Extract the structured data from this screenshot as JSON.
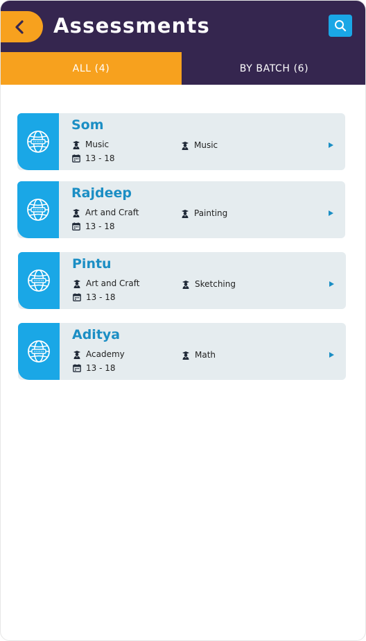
{
  "header": {
    "title": "Assessments",
    "back_icon": "chevron-left-icon",
    "search_icon": "search-icon"
  },
  "tabs": [
    {
      "label": "ALL (4)",
      "active": true
    },
    {
      "label": "BY BATCH (6)",
      "active": false
    }
  ],
  "assessments": [
    {
      "name": "Som",
      "category": "Music",
      "subject": "Music",
      "age_range": "13 - 18"
    },
    {
      "name": "Rajdeep",
      "category": "Art and Craft",
      "subject": "Painting",
      "age_range": "13 - 18"
    },
    {
      "name": "Pintu",
      "category": "Art and Craft",
      "subject": "Sketching",
      "age_range": "13 - 18"
    },
    {
      "name": "Aditya",
      "category": "Academy",
      "subject": "Math",
      "age_range": "13 - 18"
    }
  ],
  "icons": {
    "card_icon": "globe-icon",
    "category_icon": "graduate-icon",
    "subject_icon": "graduate-icon",
    "age_icon": "calendar-icon",
    "open_icon": "play-arrow-icon"
  },
  "colors": {
    "header_bg": "#35264f",
    "accent_orange": "#f7a11e",
    "accent_blue": "#1aa7e6",
    "card_bg": "#e5ecef",
    "name_color": "#1b8ec4"
  }
}
